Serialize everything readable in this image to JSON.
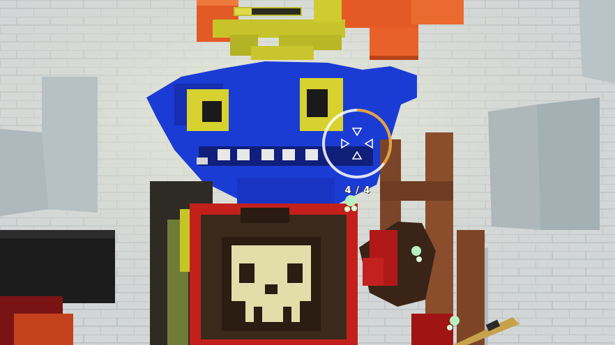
{
  "hud": {
    "ammo_counter": "4 / 4",
    "target_health_fraction": 0.25,
    "reticle_charge_fraction": 0.35
  },
  "colors": {
    "sky_wall": "#cfd3d4",
    "pinata_blue": "#1a3fd6",
    "pinata_yellow": "#d4d22a",
    "brick_orange": "#e05a2a",
    "armor_dark": "#3a2a1e",
    "armor_red": "#c8201e",
    "skull_bone": "#e6e0b0",
    "wood_brown": "#8a4a2a"
  },
  "icons": {
    "crosshair": "crosshair-icon",
    "fairy": "fairy-icon"
  }
}
